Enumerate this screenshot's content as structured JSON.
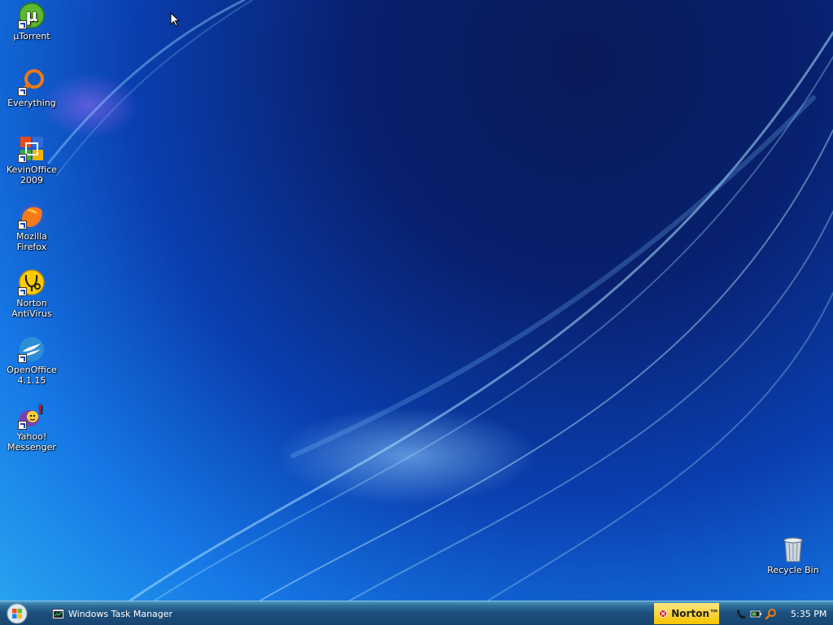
{
  "desktop": {
    "icons": [
      {
        "label": "µTorrent",
        "icon": "utorrent-icon"
      },
      {
        "label": "Everything",
        "icon": "everything-search-icon"
      },
      {
        "label": "KevinOffice 2009",
        "icon": "office-icon"
      },
      {
        "label": "Mozilla Firefox",
        "icon": "firefox-icon"
      },
      {
        "label": "Norton AntiVirus",
        "icon": "norton-antivirus-icon"
      },
      {
        "label": "OpenOffice 4.1.15",
        "icon": "openoffice-icon"
      },
      {
        "label": "Yahoo! Messenger",
        "icon": "yahoo-messenger-icon"
      },
      {
        "label": "Recycle Bin",
        "icon": "recycle-bin-icon"
      }
    ]
  },
  "taskbar": {
    "start_icon": "windows-orb-icon",
    "tasks": [
      {
        "label": "Windows Task Manager",
        "icon": "task-manager-icon"
      }
    ],
    "norton_label": "Norton™",
    "tray_icons": [
      "phone-icon",
      "battery-icon",
      "search-icon"
    ],
    "clock": "5:35 PM"
  },
  "colors": {
    "taskbar_top": "#4e9ac4",
    "taskbar_bottom": "#184570",
    "norton_yellow": "#f6c400",
    "desktop_dark": "#08206e",
    "desktop_light": "#2aa7f0"
  }
}
